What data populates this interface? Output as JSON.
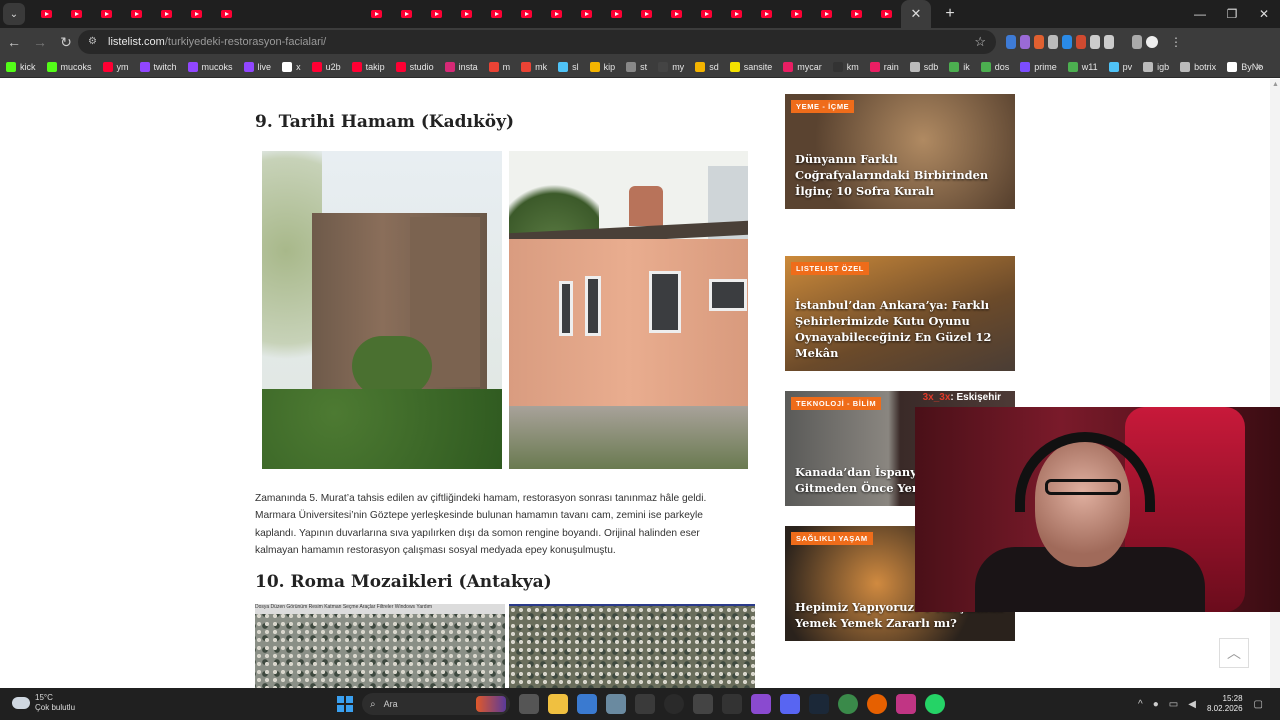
{
  "browser": {
    "url_domain": "listelist.com",
    "url_path": "/turkiyedeki-restorasyon-facialari/",
    "bookmarks": [
      "kick",
      "mucoks",
      "ym",
      "twitch",
      "mucoks",
      "live",
      "x",
      "u2b",
      "takip",
      "studio",
      "insta",
      "m",
      "mk",
      "sl",
      "kip",
      "st",
      "my",
      "sd",
      "sansite",
      "mycar",
      "km",
      "rain",
      "sdb",
      "ik",
      "dos",
      "prime",
      "w11",
      "pv",
      "igb",
      "botrix",
      "ByNo"
    ],
    "bookmark_colors": [
      "#53fc18",
      "#53fc18",
      "#ff0033",
      "#9146ff",
      "#9146ff",
      "#9146ff",
      "#ffffff",
      "#ff0033",
      "#ff0033",
      "#ff0033",
      "#d62976",
      "#ea4335",
      "#ea4335",
      "#4fc3f7",
      "#f4b400",
      "#888888",
      "#444444",
      "#f4b400",
      "#f4e200",
      "#e91e63",
      "#333333",
      "#e91e63",
      "#bbbbbb",
      "#4caf50",
      "#4caf50",
      "#7c4dff",
      "#4caf50",
      "#4fc3f7",
      "#bbbbbb",
      "#bbbbbb",
      "#ffffff"
    ],
    "tab_icon": "youtube-icon",
    "tab_count": 25
  },
  "article": {
    "heading_9": "9. Tarihi Hamam (Kadıköy)",
    "paragraph": "Zamanında 5. Murat’a tahsis edilen av çiftliğindeki hamam, restorasyon sonrası tanınmaz hâle geldi. Marmara Üniversitesi’nin Göztepe yerleşkesinde bulunan hamamın tavanı cam, zemini ise parkeyle kaplandı. Yapının duvarlarına sıva yapılırken dışı da somon rengine boyandı. Orijinal halinden eser kalmayan hamamın restorasyon çalışması sosyal medyada epey konuşulmuştu.",
    "heading_10": "10. Roma Mozaikleri (Antakya)",
    "mosaic_toolbar": "Dosya  Düzen  Görünüm  Resim  Katman  Seçme  Araçlar  Filtreler  Windows  Yardım"
  },
  "sidebar": {
    "cards": [
      {
        "badge": "YEME - İÇME",
        "title": "Dünyanın Farklı Coğrafyalarındaki Birbirinden İlginç 10 Sofra Kuralı"
      },
      {
        "badge": "LISTELIST ÖZEL",
        "title": "İstanbul’dan Ankara’ya: Farklı Şehirlerimizde Kutu Oyunu Oynayabileceğiniz En Güzel 12 Mekân"
      },
      {
        "badge": "TEKNOLOJİ - BİLİM",
        "title": "Kanada’dan İspanya’y Uzaya Gitmeden Önce Yer",
        "image_caption_red": "3x_3x",
        "image_caption": ": Eskişehir"
      },
      {
        "badge": "SAĞLIKLI YAŞAM",
        "title": "Hepimiz Yapıyoruz! T Karşısında Yemek Yemek Zararlı mı?"
      }
    ]
  },
  "taskbar": {
    "weather_temp": "15°C",
    "weather_desc": "Çok bulutlu",
    "search_placeholder": "Ara",
    "time": "15:28",
    "date": "8.02.2026"
  },
  "colors": {
    "badge": "#ef6c1a",
    "accent_blue": "#3aa0f0"
  }
}
